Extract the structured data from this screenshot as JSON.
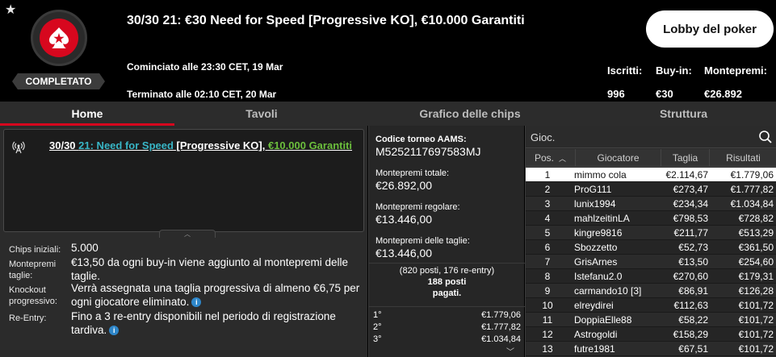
{
  "header": {
    "title": "30/30 21: €30 Need for Speed [Progressive KO], €10.000 Garantiti",
    "status": "COMPLETATO",
    "started": "Cominciato alle 23:30 CET, 19 Mar",
    "ended": "Terminato alle 02:10 CET, 20 Mar",
    "lobby_button": "Lobby del poker",
    "stats": {
      "entrants_label": "Iscritti:",
      "entrants_value": "996",
      "buyin_label": "Buy-in:",
      "buyin_value": "€30",
      "prize_label": "Montepremi:",
      "prize_value": "€26.892"
    }
  },
  "tabs": [
    "Home",
    "Tavoli",
    "Grafico delle chips",
    "Struttura"
  ],
  "info_card": {
    "title_part1": "30/30 ",
    "title_part2": "21: Need for Speed",
    "title_part3": " [Progressive KO], ",
    "title_part4": "€10.000 Garantiti"
  },
  "details": {
    "chips_label": "Chips iniziali:",
    "chips_value": "5.000",
    "bounty_label": "Montepremi taglie:",
    "bounty_value": "€13,50 da ogni buy-in viene aggiunto al montepremi delle taglie.",
    "ko_label": "Knockout progressivo:",
    "ko_value": "Verrà assegnata una taglia progressiva di almeno €6,75 per ogni giocatore eliminato.",
    "reentry_label": "Re-Entry:",
    "reentry_value": "Fino a 3 re-entry disponibili nel periodo di registrazione tardiva."
  },
  "middle": {
    "code_label": "Codice torneo AAMS:",
    "code_value": "M5252117697583MJ",
    "total_label": "Montepremi totale:",
    "total_value": "€26.892,00",
    "regular_label": "Montepremi regolare:",
    "regular_value": "€13.446,00",
    "bounty_label": "Montepremi delle taglie:",
    "bounty_value": "€13.446,00",
    "places_line1": "(820 posti, 176 re-entry)",
    "places_line2": "188 posti",
    "places_line3": "pagati.",
    "payouts": [
      {
        "place": "1°",
        "amount": "€1.779,06"
      },
      {
        "place": "2°",
        "amount": "€1.777,82"
      },
      {
        "place": "3°",
        "amount": "€1.034,84"
      }
    ]
  },
  "players": {
    "search_placeholder": "Gioc.",
    "columns": [
      "Pos.",
      "Giocatore",
      "Taglia",
      "Risultati"
    ],
    "rows": [
      {
        "pos": "1",
        "name": "mimmo cola",
        "bounty": "€2.114,67",
        "result": "€1.779,06"
      },
      {
        "pos": "2",
        "name": "ProG111",
        "bounty": "€273,47",
        "result": "€1.777,82"
      },
      {
        "pos": "3",
        "name": "lunix1994",
        "bounty": "€234,34",
        "result": "€1.034,84"
      },
      {
        "pos": "4",
        "name": "mahlzeitinLA",
        "bounty": "€798,53",
        "result": "€728,82"
      },
      {
        "pos": "5",
        "name": "kingre9816",
        "bounty": "€211,77",
        "result": "€513,29"
      },
      {
        "pos": "6",
        "name": "Sbozzetto",
        "bounty": "€52,73",
        "result": "€361,50"
      },
      {
        "pos": "7",
        "name": "GrisArnes",
        "bounty": "€13,50",
        "result": "€254,60"
      },
      {
        "pos": "8",
        "name": "Istefanu2.0",
        "bounty": "€270,60",
        "result": "€179,31"
      },
      {
        "pos": "9",
        "name": "carmando10 [3]",
        "bounty": "€86,91",
        "result": "€126,28"
      },
      {
        "pos": "10",
        "name": "elreydirei",
        "bounty": "€112,63",
        "result": "€101,72"
      },
      {
        "pos": "11",
        "name": "DoppiaElle88",
        "bounty": "€58,22",
        "result": "€101,72"
      },
      {
        "pos": "12",
        "name": "Astrogoldi",
        "bounty": "€158,29",
        "result": "€101,72"
      },
      {
        "pos": "13",
        "name": "futre1981",
        "bounty": "€67,51",
        "result": "€101,72"
      }
    ]
  },
  "colors": {
    "accent_red": "#d7071e",
    "link_cyan": "#39b6c6",
    "link_green": "#6cbf3d"
  }
}
